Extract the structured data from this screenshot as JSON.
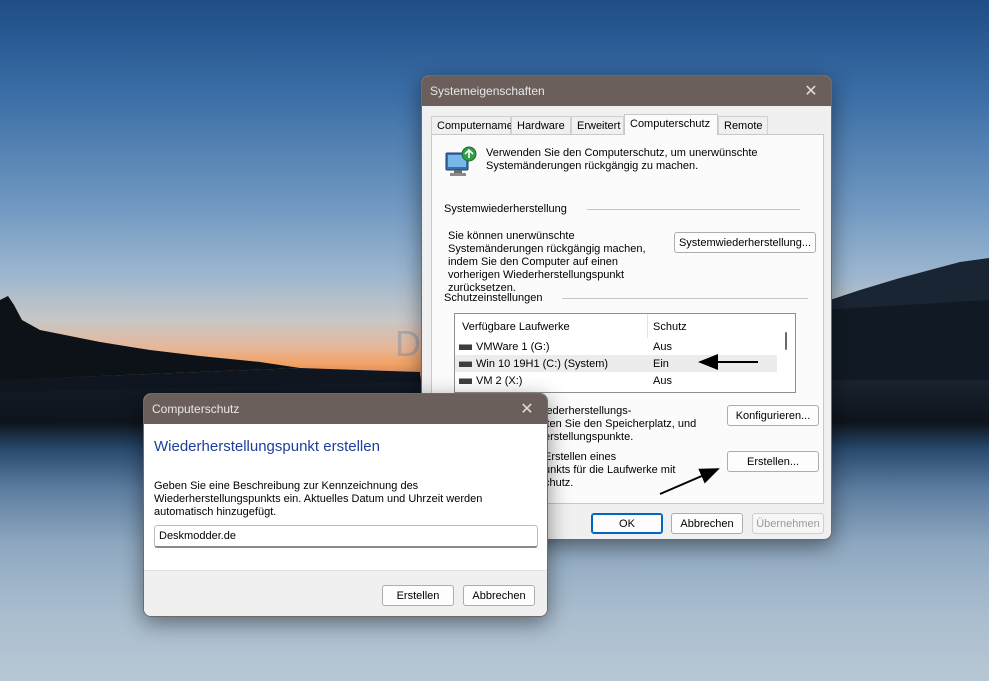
{
  "system_properties": {
    "title": "Systemeigenschaften",
    "tabs": [
      "Computername",
      "Hardware",
      "Erweitert",
      "Computerschutz",
      "Remote"
    ],
    "active_tab": "Computerschutz",
    "intro_text": "Verwenden Sie den Computerschutz, um unerwünschte Systemänderungen rückgängig zu machen.",
    "system_restore": {
      "header": "Systemwiederherstellung",
      "description": "Sie können unerwünschte Systemänderungen rückgängig machen, indem Sie den Computer auf einen vorherigen Wiederherstellungspunkt zurücksetzen.",
      "button": "Systemwiederherstellung..."
    },
    "protection_settings": {
      "header": "Schutzeinstellungen",
      "columns": [
        "Verfügbare Laufwerke",
        "Schutz"
      ],
      "rows": [
        {
          "drive": "VMWare 1 (G:)",
          "status": "Aus"
        },
        {
          "drive": "Win 10 19H1 (C:) (System)",
          "status": "Ein"
        },
        {
          "drive": "VM 2 (X:)",
          "status": "Aus"
        }
      ]
    },
    "configure_text": [
      "iederherstellungs-",
      "lten Sie den Speicherplatz, und",
      "erstellungspunkte."
    ],
    "configure_button": "Konfigurieren...",
    "create_text": [
      "Erstellen eines",
      "unkts für die Laufwerke mit",
      "chutz."
    ],
    "create_button": "Erstellen...",
    "ok_button": "OK",
    "cancel_button": "Abbrechen",
    "apply_button": "Übernehmen"
  },
  "create_dialog": {
    "title": "Computerschutz",
    "heading": "Wiederherstellungspunkt erstellen",
    "description": "Geben Sie eine Beschreibung zur Kennzeichnung des Wiederherstellungspunkts ein. Aktuelles Datum und Uhrzeit werden automatisch hinzugefügt.",
    "input_value": "Deskmodder.de",
    "create_button": "Erstellen",
    "cancel_button": "Abbrechen"
  },
  "watermark": "Deskmodder.de",
  "icons": {
    "close": "close-icon",
    "system_protection": "system-protection-icon",
    "drive": "drive-icon",
    "annotation": "annotation-arrow-icon"
  },
  "colors": {
    "titlebar": "#6b5f5b",
    "heading_blue": "#1e3f9e",
    "accent": "#0067c0"
  }
}
